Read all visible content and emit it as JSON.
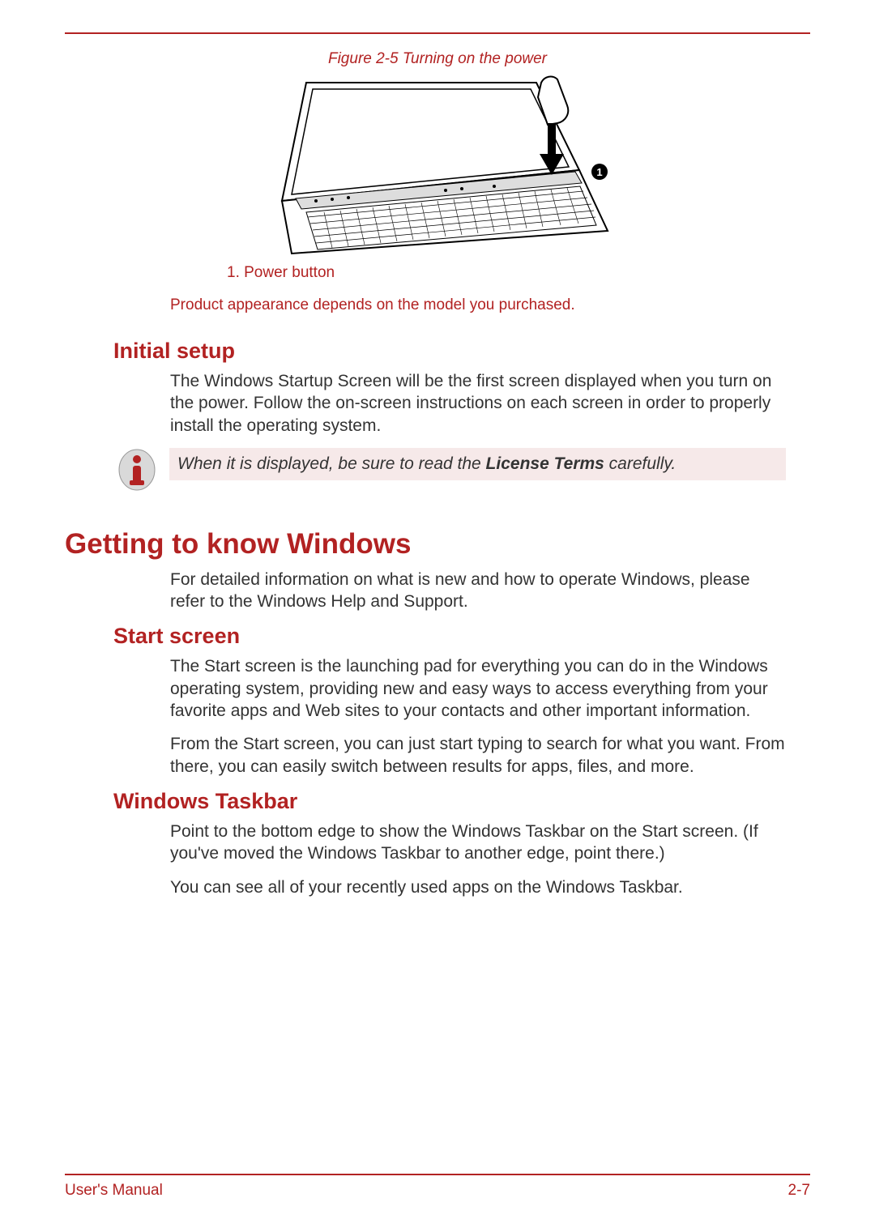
{
  "figure": {
    "caption": "Figure 2-5 Turning on the power",
    "label": "1. Power button",
    "note": "Product appearance depends on the model you purchased."
  },
  "sections": {
    "initial_setup": {
      "heading": "Initial setup",
      "body": "The Windows Startup Screen will be the first screen displayed when you turn on the power. Follow the on-screen instructions on each screen in order to properly install the operating system."
    },
    "note": {
      "prefix": "When it is displayed, be sure to read the ",
      "bold": "License Terms",
      "suffix": " carefully."
    },
    "getting_to_know": {
      "heading": "Getting to know Windows",
      "body": "For detailed information on what is new and how to operate Windows, please refer to the Windows Help and Support."
    },
    "start_screen": {
      "heading": "Start screen",
      "p1": "The Start screen is the launching pad for everything you can do in the Windows operating system, providing new and easy ways to access everything from your favorite apps and Web sites to your contacts and other important information.",
      "p2": "From the Start screen, you can just start typing to search for what you want. From there, you can easily switch between results for apps, files, and more."
    },
    "taskbar": {
      "heading": "Windows Taskbar",
      "p1": "Point to the bottom edge to show the Windows Taskbar on the Start screen. (If you've moved the Windows Taskbar to another edge, point there.)",
      "p2": "You can see all of your recently used apps on the Windows Taskbar."
    }
  },
  "footer": {
    "left": "User's Manual",
    "right": "2-7"
  }
}
